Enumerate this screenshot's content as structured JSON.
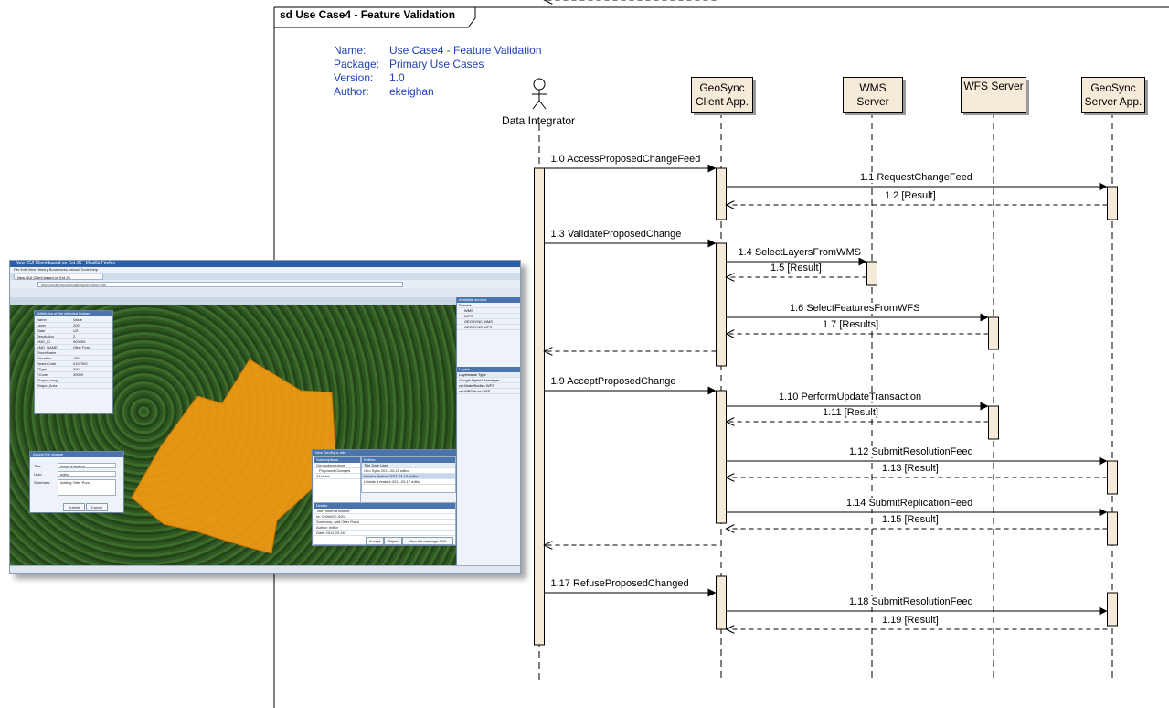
{
  "frame": {
    "title": "sd Use Case4 - Feature Validation"
  },
  "metadata": [
    {
      "key": "Name:",
      "value": "Use Case4 - Feature Validation"
    },
    {
      "key": "Package:",
      "value": "Primary Use Cases"
    },
    {
      "key": "Version:",
      "value": "1.0"
    },
    {
      "key": "Author:",
      "value": "ekeighan"
    }
  ],
  "actor": {
    "label": "Data Integrator"
  },
  "lifelines": [
    {
      "id": "client",
      "label_lines": [
        "GeoSync",
        "Client App."
      ]
    },
    {
      "id": "wms",
      "label_lines": [
        "WMS",
        "Server"
      ]
    },
    {
      "id": "wfs",
      "label_lines": [
        "WFS Server"
      ]
    },
    {
      "id": "server",
      "label_lines": [
        "GeoSync",
        "Server App."
      ]
    }
  ],
  "messages": [
    {
      "label": "1.0 AccessProposedChangeFeed",
      "from": "actor",
      "to": "client",
      "kind": "call"
    },
    {
      "label": "1.1 RequestChangeFeed",
      "from": "client",
      "to": "server",
      "kind": "call"
    },
    {
      "label": "1.2 [Result]",
      "from": "server",
      "to": "client",
      "kind": "return"
    },
    {
      "label": "1.3 ValidateProposedChange",
      "from": "actor",
      "to": "client",
      "kind": "call"
    },
    {
      "label": "1.4 SelectLayersFromWMS",
      "from": "client",
      "to": "wms",
      "kind": "call"
    },
    {
      "label": "1.5 [Result]",
      "from": "wms",
      "to": "client",
      "kind": "return"
    },
    {
      "label": "1.6 SelectFeaturesFromWFS",
      "from": "client",
      "to": "wfs",
      "kind": "call"
    },
    {
      "label": "1.7 [Results]",
      "from": "wfs",
      "to": "client",
      "kind": "return"
    },
    {
      "label": "",
      "from": "client",
      "to": "actor",
      "kind": "return"
    },
    {
      "label": "1.9 AcceptProposedChange",
      "from": "actor",
      "to": "client",
      "kind": "call"
    },
    {
      "label": "1.10 PerformUpdateTransaction",
      "from": "client",
      "to": "wfs",
      "kind": "call"
    },
    {
      "label": "1.11 [Result]",
      "from": "wfs",
      "to": "client",
      "kind": "return"
    },
    {
      "label": "1.12 SubmitResolutionFeed",
      "from": "client",
      "to": "server",
      "kind": "call"
    },
    {
      "label": "1.13 [Result]",
      "from": "server",
      "to": "client",
      "kind": "return"
    },
    {
      "label": "1.14 SubmitReplicationFeed",
      "from": "client",
      "to": "server",
      "kind": "call"
    },
    {
      "label": "1.15 [Result]",
      "from": "server",
      "to": "client",
      "kind": "return"
    },
    {
      "label": "",
      "from": "client",
      "to": "actor",
      "kind": "return"
    },
    {
      "label": "1.17 RefuseProposedChanged",
      "from": "actor",
      "to": "client",
      "kind": "call"
    },
    {
      "label": "1.18 SubmitResolutionFeed",
      "from": "client",
      "to": "server",
      "kind": "call"
    },
    {
      "label": "1.19 [Result]",
      "from": "server",
      "to": "client",
      "kind": "return"
    },
    {
      "label": "",
      "from": "client",
      "to": "actor",
      "kind": "return"
    }
  ],
  "screenshot": {
    "window_title": "New GUI Client based on Ext JS - Mozilla Firefox",
    "menu": "File  Edit  View  History  Bookmarks  Yahoo!  Tools  Help",
    "tab_label": "New GUI Client based on Ext JS",
    "url": "http://localhost:8080/geosync/client.html",
    "attributes_panel": {
      "title": "Attributes of the selected feature",
      "rows": [
        [
          "Name",
          "Value"
        ],
        [
          "Layer",
          "200"
        ],
        [
          "State",
          "US"
        ],
        [
          "Resolution",
          "2"
        ],
        [
          "VMD_ID",
          "500059"
        ],
        [
          "VMD_NAME",
          "Otter Pond"
        ],
        [
          "ShoreName",
          ""
        ],
        [
          "Elevation",
          "185"
        ],
        [
          "ReachCode",
          "0107000"
        ],
        [
          "FType",
          "390"
        ],
        [
          "FCode",
          "39009"
        ],
        [
          "Shape_Leng",
          ""
        ],
        [
          "Shape_Area",
          ""
        ]
      ]
    },
    "accept_dialog": {
      "title": "Accept the change",
      "title_label": "Title:",
      "title_value": "Insert a feature",
      "user_label": "User:",
      "user_value": "editor",
      "summary_label": "Summary:",
      "summary_value": "Adding Otter Pond",
      "submit": "Submit",
      "cancel": "Cancel"
    },
    "changes_panel": {
      "title": "New GeoSync Info",
      "subscriptions_header": "Subscriptions",
      "subscriptions": [
        "Geo subscriptions",
        "Proposed Changes",
        "All items"
      ],
      "entries_header": "Entries",
      "entries_columns": [
        "Title",
        "Date",
        "User"
      ],
      "entries": [
        [
          "Geo Sync",
          "2011-03-15",
          "editor"
        ],
        [
          "Insert a feature",
          "2011-03-16",
          "editor"
        ],
        [
          "Update a feature",
          "2011-03-17",
          "editor"
        ]
      ],
      "details_header": "Details",
      "details_rows": [
        "Title:  Insert a feature",
        "Id:  CHANGE-0001",
        "Summary:  Add Otter Pond",
        "Author:  editor",
        "Date:  2011-03-16"
      ],
      "buttons": [
        "Accept",
        "Reject",
        "View the message XML"
      ]
    },
    "right_panel": {
      "available_servers": "Available servers",
      "servers": [
        "Servers",
        "WMS",
        "WFS",
        "GEOSYNC WMS",
        "GEOSYNC WFS"
      ],
      "layers_header": "Layers",
      "layers_columns": [
        "Layername",
        "Type"
      ],
      "layers": [
        [
          "Google Hybrid",
          "Baselayer"
        ],
        [
          "csi:WaterBodies",
          "WFS"
        ],
        [
          "csi:WBDHucs",
          "WFS"
        ]
      ]
    }
  }
}
